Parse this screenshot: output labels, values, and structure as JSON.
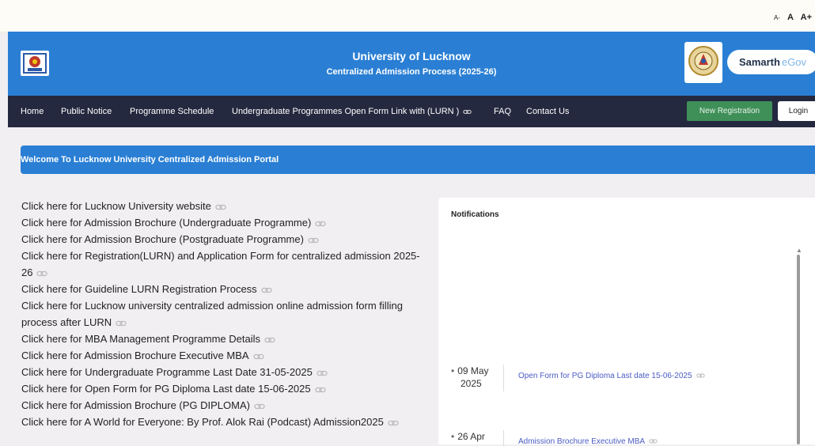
{
  "font_controls": {
    "small": "A-",
    "normal": "A",
    "large": "A+"
  },
  "header": {
    "title": "University of Lucknow",
    "subtitle": "Centralized Admission Process (2025-26)",
    "brand_main": "Samarth",
    "brand_suffix": "eGov"
  },
  "nav": {
    "items": [
      "Home",
      "Public Notice",
      "Programme Schedule",
      "Undergraduate Programmes Open Form Link with (LURN )",
      "FAQ",
      "Contact Us"
    ],
    "new_registration": "New Registration",
    "login": "Login"
  },
  "welcome": "Welcome To Lucknow University Centralized Admission Portal",
  "links": [
    "Click here for Lucknow University website",
    "Click here for Admission Brochure (Undergraduate Programme)",
    "Click here for Admission Brochure (Postgraduate Programme)",
    "Click here for Registration(LURN) and Application Form for centralized admission 2025-26",
    "Click here for Guideline LURN Registration Process",
    "Click here for Lucknow university centralized admission online admission form filling process after LURN",
    "Click here for MBA Management Programme Details",
    "Click here for Admission Brochure Executive MBA",
    "Click here for Undergraduate Programme Last Date 31-05-2025",
    "Click here for Open Form for PG Diploma Last date 15-06-2025",
    "Click here for Admission Brochure (PG DIPLOMA)",
    "Click here for A World for Everyone: By Prof. Alok Rai (Podcast) Admission2025"
  ],
  "notifications": {
    "title": "Notifications",
    "items": [
      {
        "date_line1": "09 May",
        "date_line2": "2025",
        "text": "Open Form for PG Diploma Last date 15-06-2025"
      },
      {
        "date_line1": "26 Apr",
        "date_line2": "",
        "text": "Admission Brochure Executive MBA"
      }
    ]
  },
  "colors": {
    "header_blue": "#2a7fd4",
    "nav_dark": "#25293f",
    "button_green": "#3f8f58",
    "link_blue": "#4a5bc4"
  }
}
